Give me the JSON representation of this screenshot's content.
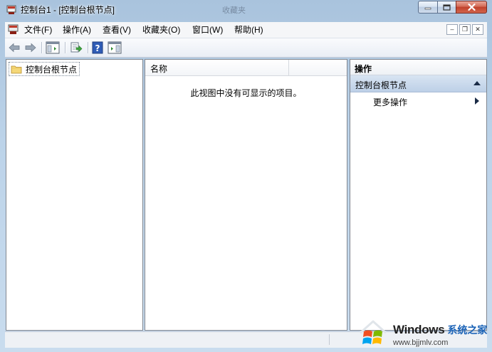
{
  "window": {
    "title": "控制台1 - [控制台根节点]",
    "background_ghost": [
      "收藏夹"
    ],
    "caption_buttons": {
      "minimize": "minimize",
      "maximize": "maximize",
      "close": "close"
    }
  },
  "menubar": {
    "items": [
      "文件(F)",
      "操作(A)",
      "查看(V)",
      "收藏夹(O)",
      "窗口(W)",
      "帮助(H)"
    ]
  },
  "toolbar": {
    "icons": [
      "back-arrow-icon",
      "forward-arrow-icon",
      "show-hide-tree-icon",
      "export-list-icon",
      "help-icon",
      "show-hide-action-pane-icon"
    ]
  },
  "tree": {
    "root_label": "控制台根节点"
  },
  "list": {
    "column_name": "名称",
    "empty_message": "此视图中没有可显示的项目。"
  },
  "actions": {
    "title": "操作",
    "section": "控制台根节点",
    "more_actions": "更多操作"
  },
  "watermark": {
    "brand": "Windows",
    "cn": "系统之家",
    "url": "www.bjjmlv.com"
  },
  "colors": {
    "accent": "#bdd0e7",
    "close_button": "#c0412b"
  }
}
